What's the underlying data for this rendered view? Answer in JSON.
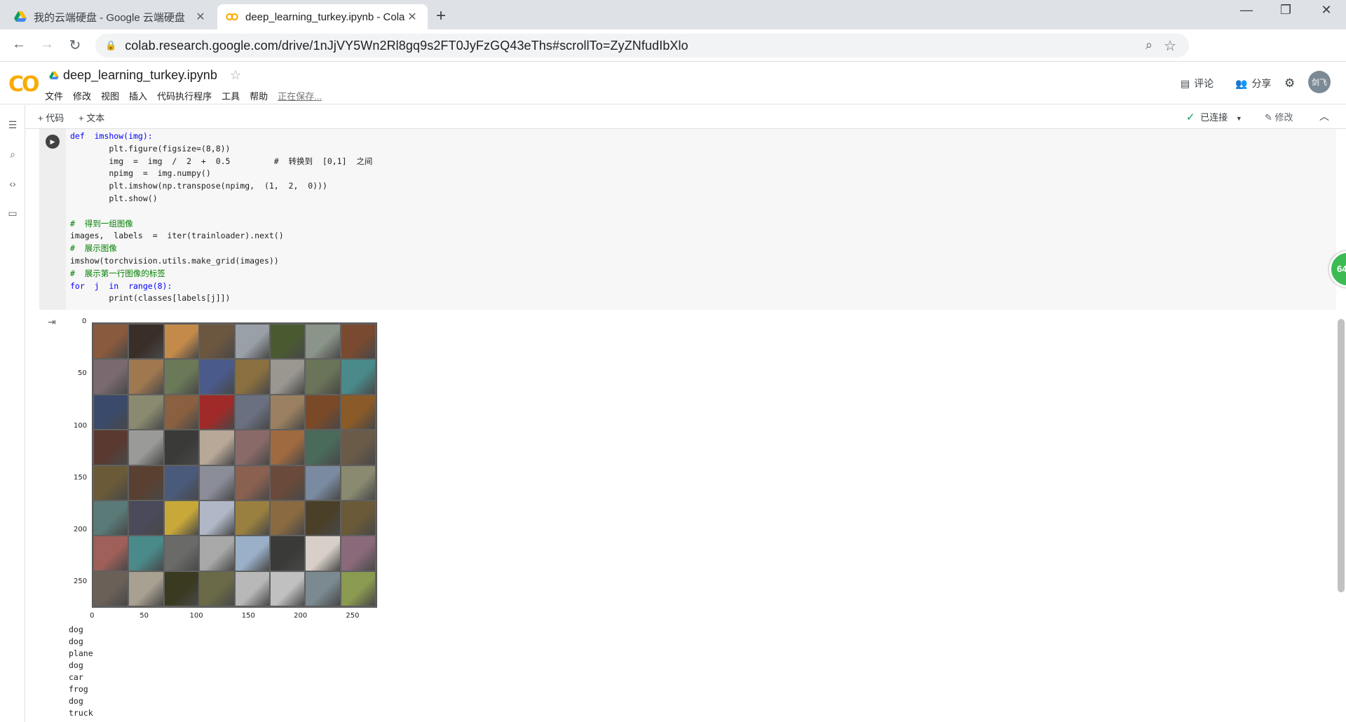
{
  "browser": {
    "tabs": [
      {
        "title": "我的云端硬盘 - Google 云端硬盘",
        "active": false,
        "favicon": "google-drive-icon"
      },
      {
        "title": "deep_learning_turkey.ipynb - Colaboratory",
        "active": true,
        "favicon": "colab-icon"
      }
    ],
    "url": "colab.research.google.com/drive/1nJjVY5Wn2Rl8gq9s2FT0JyFzGQ43eThs#scrollTo=ZyZNfudIbXlo",
    "profile": "剑飞"
  },
  "colab": {
    "logo": "CO",
    "notebook_title": "deep_learning_turkey.ipynb",
    "menu": [
      "文件",
      "修改",
      "视图",
      "插入",
      "代码执行程序",
      "工具",
      "帮助"
    ],
    "save_status": "正在保存...",
    "comment_label": "评论",
    "share_label": "分享",
    "avatar": "剑飞",
    "add_code": "+ 代码",
    "add_text": "+ 文本",
    "connection": "已连接",
    "edit_label": "修改",
    "badge": "64"
  },
  "code_cell": {
    "lines": [
      "def  imshow(img):",
      "        plt.figure(figsize=(8,8))",
      "        img  =  img  /  2  +  0.5         #  转换到  [0,1]  之间",
      "        npimg  =  img.numpy()",
      "        plt.imshow(np.transpose(npimg,  (1,  2,  0)))",
      "        plt.show()",
      "",
      "#  得到一组图像",
      "images,  labels  =  iter(trainloader).next()",
      "#  展示图像",
      "imshow(torchvision.utils.make_grid(images))",
      "#  展示第一行图像的标签",
      "for  j  in  range(8):",
      "        print(classes[labels[j]])"
    ]
  },
  "output": {
    "y_ticks": [
      "0",
      "50",
      "100",
      "150",
      "200",
      "250"
    ],
    "x_ticks": [
      "0",
      "50",
      "100",
      "150",
      "200",
      "250"
    ],
    "printed_labels": [
      "dog",
      "dog",
      "plane",
      "dog",
      "car",
      "frog",
      "dog",
      "truck"
    ],
    "tile_colors": [
      "#8a5a3c",
      "#3a2e28",
      "#c48a4a",
      "#6b5640",
      "#9aa0a8",
      "#4a5a30",
      "#8a9488",
      "#7a4a30",
      "#7a6a70",
      "#a07850",
      "#6a7a58",
      "#4a5a8a",
      "#8a7040",
      "#9a9690",
      "#6a7458",
      "#4a8a8a",
      "#3a4a6a",
      "#8a8a70",
      "#8a6040",
      "#a02a28",
      "#6a7080",
      "#9a8060",
      "#7a4a28",
      "#8a5a28",
      "#5a3a30",
      "#9a9a98",
      "#3a3a38",
      "#b8a898",
      "#8a6a68",
      "#a06a40",
      "#4a6a5a",
      "#6a5a48",
      "#6a5a38",
      "#5a4030",
      "#4a5a7a",
      "#8a8c98",
      "#8a6050",
      "#6a4a3a",
      "#7a8aa0",
      "#8a8a70",
      "#5a7a78",
      "#4a4a5a",
      "#c8a838",
      "#b0b8c8",
      "#9a8040",
      "#8a6a40",
      "#4a4028",
      "#6a5a38",
      "#a0605a",
      "#4a8a8a",
      "#6a6a68",
      "#a8a8a8",
      "#9ab0c8",
      "#3a3a38",
      "#d8d0c8",
      "#8a6a7a",
      "#6a6058",
      "#a8a090",
      "#3a3a20",
      "#6a6a48",
      "#b8b8b8",
      "#c0c0c0",
      "#7a8a90",
      "#8a9a50"
    ]
  }
}
